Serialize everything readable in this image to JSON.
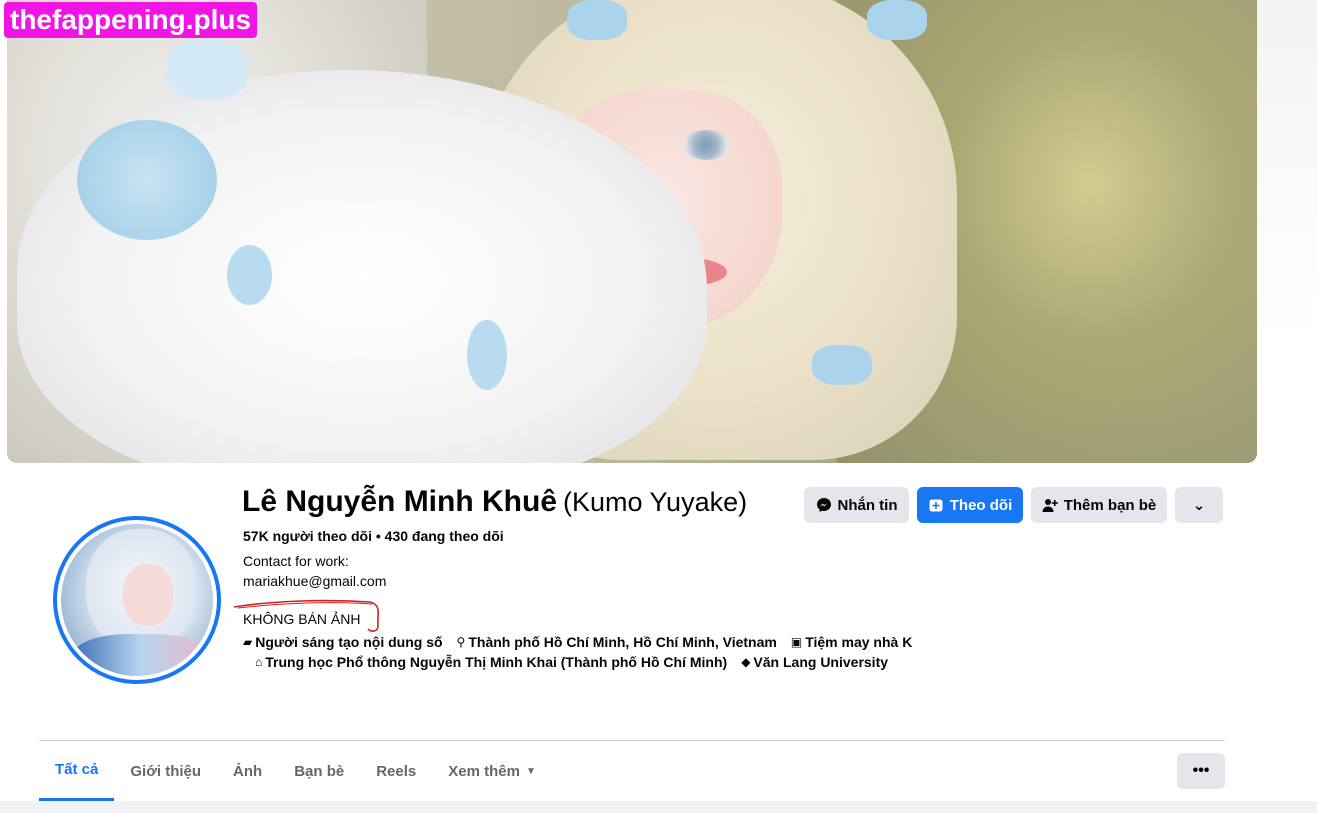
{
  "watermark": "thefappening.plus",
  "profile": {
    "name": "Lê Nguyễn Minh Khuê",
    "alias": "(Kumo Yuyake)",
    "stats": "57K người theo dõi • 430 đang theo dõi",
    "bio_line1": "Contact for work:",
    "bio_line2": "mariakhue@gmail.com",
    "bio_note": "KHÔNG BÁN ẢNH",
    "meta_row1": [
      {
        "icon": "briefcase-icon",
        "glyph": "▰",
        "text": "Người sáng tạo nội dung số"
      },
      {
        "icon": "location-pin-icon",
        "glyph": "⚲",
        "text": "Thành phố Hồ Chí Minh, Hồ Chí Minh, Vietnam"
      },
      {
        "icon": "shop-icon",
        "glyph": "▣",
        "text": "Tiệm may nhà K"
      }
    ],
    "meta_row2": [
      {
        "icon": "school-icon",
        "glyph": "⌂",
        "text": "Trung học Phổ thông Nguyễn Thị Minh Khai (Thành phố Hồ Chí Minh)"
      },
      {
        "icon": "graduation-cap-icon",
        "glyph": "◆",
        "text": "Văn Lang University"
      }
    ]
  },
  "actions": {
    "message": "Nhắn tin",
    "follow": "Theo dõi",
    "add_friend": "Thêm bạn bè",
    "more": "⌄"
  },
  "tabs": [
    {
      "label": "Tất cả",
      "active": true
    },
    {
      "label": "Giới thiệu"
    },
    {
      "label": "Ảnh"
    },
    {
      "label": "Bạn bè"
    },
    {
      "label": "Reels"
    },
    {
      "label": "Xem thêm"
    }
  ],
  "tabs_more": "•••",
  "colors": {
    "accent": "#1877f2",
    "button_grey": "#e4e6eb",
    "watermark": "#f015e4"
  }
}
